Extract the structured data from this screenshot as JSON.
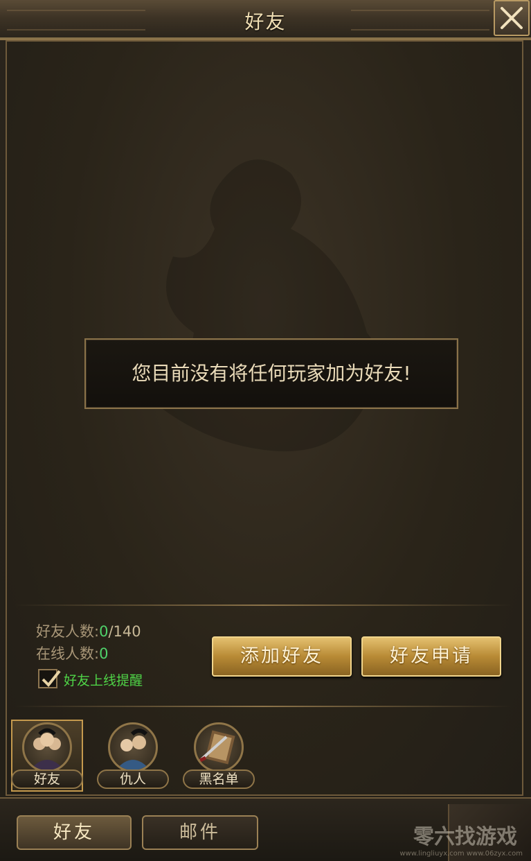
{
  "window": {
    "title": "好友"
  },
  "empty_message": "您目前没有将任何玩家加为好友!",
  "stats": {
    "friend_count_label": "好友人数:",
    "friend_count": "0",
    "friend_max": "/140",
    "online_count_label": "在线人数:",
    "online_count": "0"
  },
  "reminder": {
    "label": "好友上线提醒",
    "checked": true
  },
  "buttons": {
    "add_friend": "添加好友",
    "friend_requests": "好友申请"
  },
  "categories": [
    {
      "label": "好友",
      "icon": "friends-portrait-icon",
      "active": true
    },
    {
      "label": "仇人",
      "icon": "enemies-portrait-icon",
      "active": false
    },
    {
      "label": "黑名单",
      "icon": "blacklist-book-icon",
      "active": false
    }
  ],
  "tabs": [
    {
      "label": "好友",
      "active": true
    },
    {
      "label": "邮件",
      "active": false
    }
  ],
  "watermark": {
    "text": "零六找游戏",
    "url": "www.lingliuyx.com www.06zyx.com"
  },
  "colors": {
    "gold": "#d7ad5a",
    "green": "#4fd26a",
    "panel": "#2a2419"
  }
}
